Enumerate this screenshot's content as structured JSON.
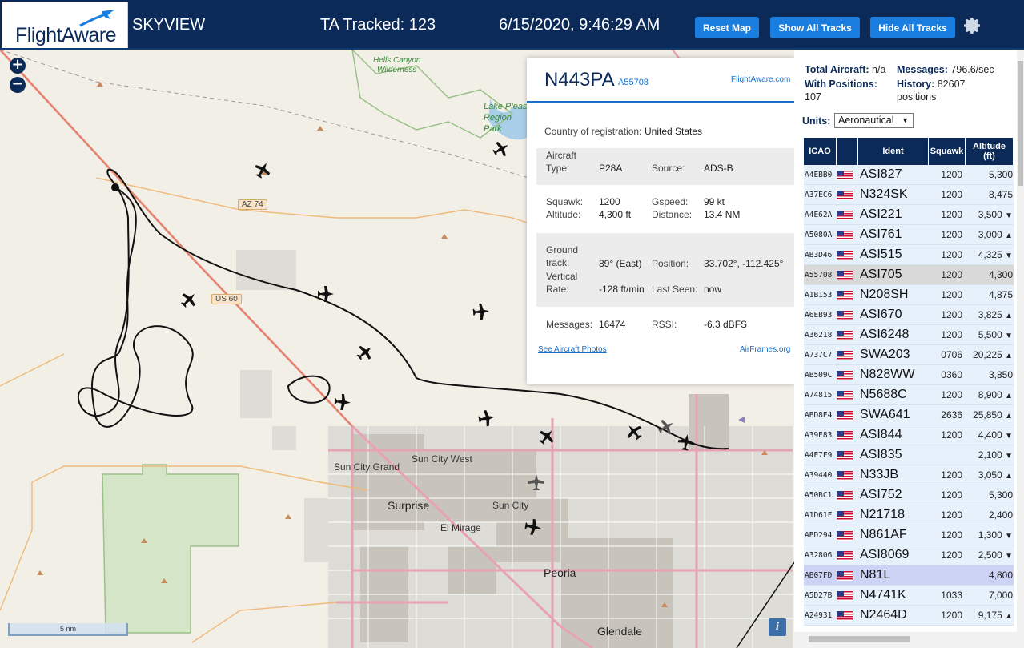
{
  "header": {
    "logo": "FlightAware",
    "app_name": "SKYVIEW",
    "tracked": "TA Tracked: 123",
    "datetime": "6/15/2020, 9:46:29 AM",
    "buttons": {
      "reset": "Reset Map",
      "show_all": "Show All Tracks",
      "hide_all": "Hide All Tracks"
    }
  },
  "map": {
    "zoom_in": "+",
    "zoom_out": "−",
    "scale": "5 nm",
    "info": "i",
    "labels": {
      "hells_canyon": "Hells Canyon\nWilderness",
      "lake_pleasant": "Lake Pleas\nRegion\nPark",
      "sun_city_grand": "Sun City Grand",
      "sun_city_west": "Sun City West",
      "surprise": "Surprise",
      "sun_city": "Sun City",
      "el_mirage": "El Mirage",
      "peoria": "Peoria",
      "glendale": "Glendale"
    },
    "highways": {
      "az74": "AZ 74",
      "us60": "US 60"
    }
  },
  "popup": {
    "callsign": "N443PA",
    "hex": "A55708",
    "fa_link": "FlightAware.com",
    "country_label": "Country of registration:",
    "country": "United States",
    "type_label": "Aircraft\nType:",
    "type": "P28A",
    "source_label": "Source:",
    "source": "ADS-B",
    "squawk_label": "Squawk:",
    "squawk": "1200",
    "altitude_label": "Altitude:",
    "altitude": "4,300 ft",
    "gspeed_label": "Gspeed:",
    "gspeed": "99 kt",
    "distance_label": "Distance:",
    "distance": "13.4 NM",
    "track_label": "Ground\ntrack:",
    "track": "89° (East)",
    "position_label": "Position:",
    "position": "33.702°, -112.425°",
    "vrate_label": "Vertical\nRate:",
    "vrate": "-128 ft/min",
    "lastseen_label": "Last Seen:",
    "lastseen": "now",
    "messages_label": "Messages:",
    "messages": "16474",
    "rssi_label": "RSSI:",
    "rssi": "-6.3 dBFS",
    "photos_link": "See Aircraft Photos",
    "airframes_link": "AirFrames.org"
  },
  "panel": {
    "total_label": "Total Aircraft:",
    "total": "n/a",
    "messages_label": "Messages:",
    "messages": "796.6/sec",
    "positions_label": "With Positions:",
    "positions": "107",
    "history_label": "History:",
    "history": "82607",
    "history_unit": "positions",
    "units_label": "Units:",
    "units_value": "Aeronautical",
    "columns": [
      "ICAO",
      "",
      "Ident",
      "Squawk",
      "Altitude\n(ft)"
    ],
    "rows": [
      {
        "icao": "A4EBB0",
        "ident": "ASI827",
        "squawk": "1200",
        "alt": "5,300",
        "trend": ""
      },
      {
        "icao": "A37EC6",
        "ident": "N324SK",
        "squawk": "1200",
        "alt": "8,475",
        "trend": ""
      },
      {
        "icao": "A4E62A",
        "ident": "ASI221",
        "squawk": "1200",
        "alt": "3,500",
        "trend": "▼"
      },
      {
        "icao": "A5080A",
        "ident": "ASI761",
        "squawk": "1200",
        "alt": "3,000",
        "trend": "▲"
      },
      {
        "icao": "AB3D46",
        "ident": "ASI515",
        "squawk": "1200",
        "alt": "4,325",
        "trend": "▼"
      },
      {
        "icao": "A55708",
        "ident": "ASI705",
        "squawk": "1200",
        "alt": "4,300",
        "trend": "",
        "state": "sel"
      },
      {
        "icao": "A1B153",
        "ident": "N208SH",
        "squawk": "1200",
        "alt": "4,875",
        "trend": ""
      },
      {
        "icao": "A6EB93",
        "ident": "ASI670",
        "squawk": "1200",
        "alt": "3,825",
        "trend": "▲"
      },
      {
        "icao": "A36218",
        "ident": "ASI6248",
        "squawk": "1200",
        "alt": "5,500",
        "trend": "▼"
      },
      {
        "icao": "A737C7",
        "ident": "SWA203",
        "squawk": "0706",
        "alt": "20,225",
        "trend": "▲"
      },
      {
        "icao": "AB509C",
        "ident": "N828WW",
        "squawk": "0360",
        "alt": "3,850",
        "trend": ""
      },
      {
        "icao": "A74815",
        "ident": "N5688C",
        "squawk": "1200",
        "alt": "8,900",
        "trend": "▲"
      },
      {
        "icao": "ABD8E4",
        "ident": "SWA641",
        "squawk": "2636",
        "alt": "25,850",
        "trend": "▲"
      },
      {
        "icao": "A39E83",
        "ident": "ASI844",
        "squawk": "1200",
        "alt": "4,400",
        "trend": "▼"
      },
      {
        "icao": "A4E7F9",
        "ident": "ASI835",
        "squawk": "",
        "alt": "2,100",
        "trend": "▼"
      },
      {
        "icao": "A39440",
        "ident": "N33JB",
        "squawk": "1200",
        "alt": "3,050",
        "trend": "▲"
      },
      {
        "icao": "A50BC1",
        "ident": "ASI752",
        "squawk": "1200",
        "alt": "5,300",
        "trend": ""
      },
      {
        "icao": "A1D61F",
        "ident": "N21718",
        "squawk": "1200",
        "alt": "2,400",
        "trend": ""
      },
      {
        "icao": "ABD294",
        "ident": "N861AF",
        "squawk": "1200",
        "alt": "1,300",
        "trend": "▼"
      },
      {
        "icao": "A32806",
        "ident": "ASI8069",
        "squawk": "1200",
        "alt": "2,500",
        "trend": "▼"
      },
      {
        "icao": "AB07FD",
        "ident": "N81L",
        "squawk": "",
        "alt": "4,800",
        "trend": "",
        "state": "hl"
      },
      {
        "icao": "A5D27B",
        "ident": "N4741K",
        "squawk": "1033",
        "alt": "7,000",
        "trend": ""
      },
      {
        "icao": "A24931",
        "ident": "N2464D",
        "squawk": "1200",
        "alt": "9,175",
        "trend": "▲"
      }
    ]
  },
  "colors": {
    "header_bg": "#0b2a57",
    "button_bg": "#1a7ee0",
    "row_bg": "#e6f1fb",
    "row_selected": "#d9d9d9",
    "row_highlight": "#cdd3f5"
  },
  "icons": {
    "settings": "gear-icon",
    "logo": "plane-icon"
  }
}
